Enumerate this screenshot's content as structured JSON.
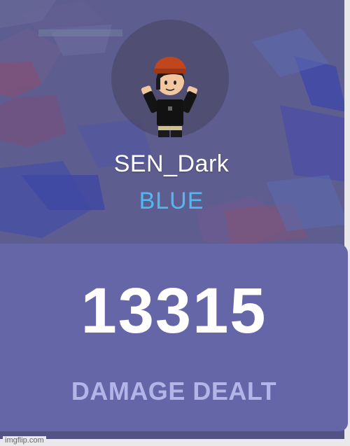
{
  "player": {
    "name": "SEN_Dark",
    "team": "BLUE",
    "team_color": "#52b8f0"
  },
  "stat": {
    "value": "13315",
    "label": "DAMAGE DEALT",
    "label_color": "#b3b5e8",
    "card_color": "#6466a8"
  },
  "avatar": {
    "icon": "player-avatar-icon"
  },
  "watermark": "imgflip.com"
}
